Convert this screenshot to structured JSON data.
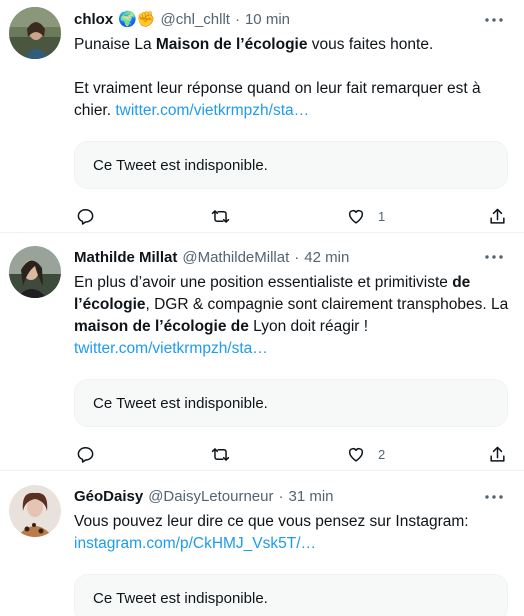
{
  "tweets": [
    {
      "name": "chlox",
      "badges": "🌍✊",
      "handle": "@chl_chllt",
      "time": "10 min",
      "lines": [
        [
          {
            "t": "Punaise La "
          },
          {
            "t": "Maison de l’écologie",
            "b": true
          },
          {
            "t": " vous faites honte."
          }
        ],
        [],
        [
          {
            "t": "Et vraiment leur réponse quand on leur fait remarquer est à chier. "
          },
          {
            "t": "twitter.com/vietkrmpzh/sta…",
            "link": true
          }
        ]
      ],
      "quote": "Ce Tweet est indisponible.",
      "likes": "1",
      "avatar": "avatar-chlox"
    },
    {
      "name": "Mathilde Millat",
      "badges": "",
      "handle": "@MathildeMillat",
      "time": "42 min",
      "lines": [
        [
          {
            "t": "En plus d’avoir une position essentialiste et primitiviste "
          },
          {
            "t": "de l’écologie",
            "b": true
          },
          {
            "t": ", DGR & compagnie sont clairement transphobes. La "
          },
          {
            "t": "maison de l’écologie de",
            "b": true
          },
          {
            "t": " Lyon doit réagir ! "
          },
          {
            "t": "twitter.com/vietkrmpzh/sta…",
            "link": true
          }
        ]
      ],
      "quote": "Ce Tweet est indisponible.",
      "likes": "2",
      "avatar": "avatar-mathilde"
    },
    {
      "name": "GéoDaisy",
      "badges": "",
      "handle": "@DaisyLetourneur",
      "time": "31 min",
      "lines": [
        [
          {
            "t": "Vous pouvez leur dire ce que vous pensez sur Instagram: "
          },
          {
            "t": "instagram.com/p/CkHMJ_Vsk5T/…",
            "link": true
          }
        ]
      ],
      "quote": "Ce Tweet est indisponible.",
      "likes": "",
      "avatar": "avatar-geodaisy"
    }
  ],
  "dot": "·",
  "colors": {
    "link": "#1d9bf0",
    "secondary_text": "#536471",
    "quote_bg": "#f7f9f9"
  }
}
